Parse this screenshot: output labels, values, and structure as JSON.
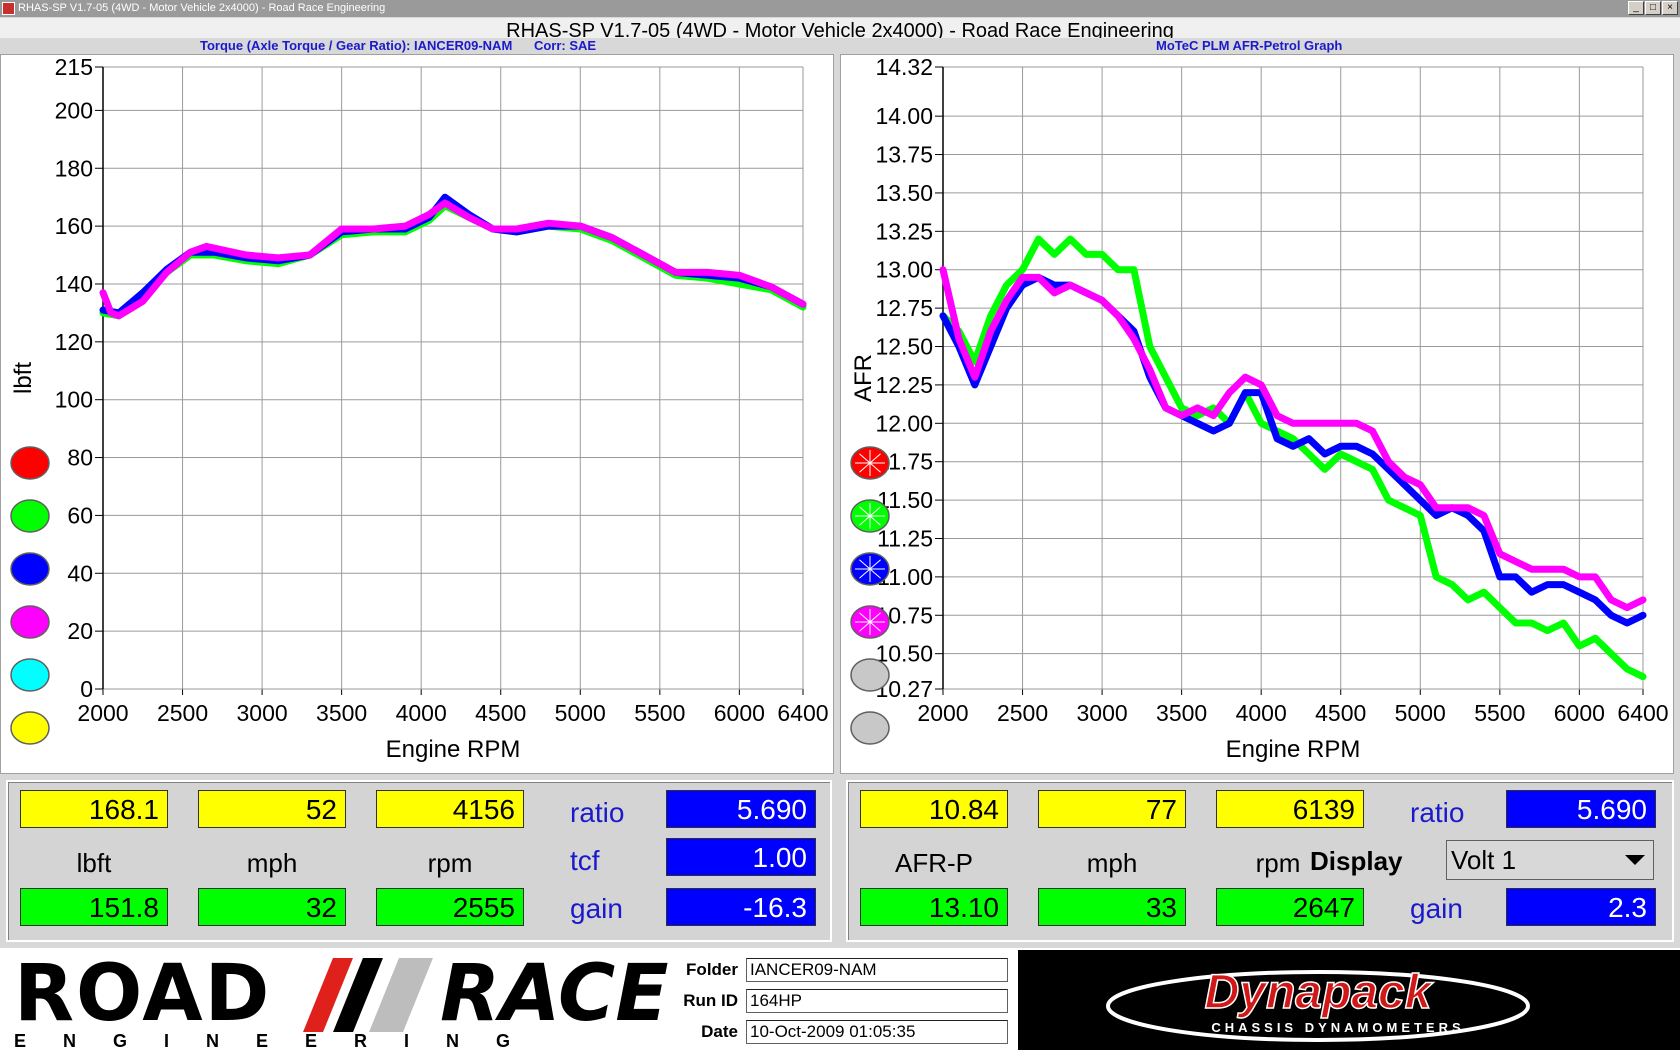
{
  "window": {
    "title": "RHAS-SP V1.7-05   (4WD - Motor Vehicle 2x4000) - Road Race Engineering",
    "heading": "RHAS-SP V1.7-05   (4WD - Motor Vehicle 2x4000) - Road Race Engineering",
    "controls": [
      "_",
      "□",
      "×"
    ]
  },
  "left_graph": {
    "subtitle": "Torque (Axle Torque / Gear Ratio): IANCER09-NAM      Corr: SAE",
    "legend_colors": [
      "#ff0000",
      "#00ff00",
      "#0000ff",
      "#ff00ff",
      "#00ffff",
      "#ffff00"
    ]
  },
  "right_graph": {
    "subtitle": "MoTeC PLM AFR-Petrol Graph",
    "legend_colors": [
      "#ff0000",
      "#00ff00",
      "#0000ff",
      "#ff00ff",
      "#c8c8c8",
      "#c8c8c8"
    ]
  },
  "chart_data": [
    {
      "type": "line",
      "title": "Torque (Axle Torque / Gear Ratio): IANCER09-NAM      Corr: SAE",
      "xlabel": "Engine RPM",
      "ylabel": "lbft",
      "xlim": [
        2000,
        6400
      ],
      "ylim": [
        0,
        215
      ],
      "xticks": [
        2000,
        2500,
        3000,
        3500,
        4000,
        4500,
        5000,
        5500,
        6000,
        6400
      ],
      "yticks": [
        0,
        20,
        40,
        60,
        80,
        100,
        120,
        140,
        160,
        180,
        200,
        215
      ],
      "grid": true,
      "series": [
        {
          "color": "#00ff00",
          "x": [
            2000,
            2100,
            2250,
            2400,
            2550,
            2700,
            2900,
            3100,
            3300,
            3500,
            3700,
            3900,
            4050,
            4150,
            4300,
            4450,
            4600,
            4800,
            5000,
            5200,
            5400,
            5600,
            5800,
            6000,
            6200,
            6400
          ],
          "values": [
            130,
            129,
            136,
            144,
            150,
            150,
            148,
            147,
            150,
            157,
            158,
            158,
            162,
            167,
            163,
            159,
            158,
            160,
            159,
            155,
            149,
            143,
            142,
            140,
            138,
            132
          ]
        },
        {
          "color": "#0000ff",
          "x": [
            2000,
            2100,
            2250,
            2400,
            2550,
            2700,
            2900,
            3100,
            3300,
            3500,
            3700,
            3900,
            4050,
            4150,
            4300,
            4450,
            4600,
            4800,
            5000,
            5200,
            5400,
            5600,
            5800,
            6000,
            6200,
            6400
          ],
          "values": [
            131,
            130,
            137,
            145,
            151,
            151,
            149,
            148,
            150,
            158,
            159,
            159,
            163,
            170,
            164,
            159,
            158,
            160,
            160,
            156,
            150,
            144,
            143,
            142,
            139,
            133
          ]
        },
        {
          "color": "#ff00ff",
          "x": [
            2000,
            2050,
            2100,
            2250,
            2400,
            2550,
            2650,
            2900,
            3100,
            3300,
            3500,
            3700,
            3900,
            4050,
            4150,
            4300,
            4450,
            4600,
            4800,
            5000,
            5200,
            5400,
            5600,
            5800,
            6000,
            6200,
            6400
          ],
          "values": [
            137,
            130,
            129,
            134,
            144,
            151,
            153,
            150,
            149,
            150,
            159,
            159,
            160,
            164,
            168,
            163,
            159,
            159,
            161,
            160,
            156,
            150,
            144,
            144,
            143,
            139,
            133
          ]
        }
      ]
    },
    {
      "type": "line",
      "title": "MoTeC PLM AFR-Petrol Graph",
      "xlabel": "Engine RPM",
      "ylabel": "AFR",
      "xlim": [
        2000,
        6400
      ],
      "ylim": [
        10.27,
        14.32
      ],
      "xticks": [
        2000,
        2500,
        3000,
        3500,
        4000,
        4500,
        5000,
        5500,
        6000,
        6400
      ],
      "yticks": [
        10.27,
        10.5,
        10.75,
        11.0,
        11.25,
        11.5,
        11.75,
        12.0,
        12.25,
        12.5,
        12.75,
        13.0,
        13.25,
        13.5,
        13.75,
        14.0,
        14.32
      ],
      "grid": true,
      "series": [
        {
          "color": "#00ff00",
          "x": [
            2000,
            2100,
            2200,
            2300,
            2400,
            2500,
            2600,
            2700,
            2800,
            2900,
            3000,
            3100,
            3200,
            3300,
            3400,
            3500,
            3600,
            3700,
            3800,
            3900,
            4000,
            4100,
            4200,
            4300,
            4400,
            4500,
            4600,
            4700,
            4800,
            4900,
            5000,
            5100,
            5200,
            5300,
            5400,
            5500,
            5600,
            5700,
            5800,
            5900,
            6000,
            6100,
            6200,
            6300,
            6400
          ],
          "values": [
            12.7,
            12.6,
            12.4,
            12.7,
            12.9,
            13.0,
            13.2,
            13.1,
            13.2,
            13.1,
            13.1,
            13.0,
            13.0,
            12.5,
            12.3,
            12.1,
            12.05,
            12.1,
            12.0,
            12.2,
            12.0,
            11.95,
            11.9,
            11.8,
            11.7,
            11.8,
            11.75,
            11.7,
            11.5,
            11.45,
            11.4,
            11.0,
            10.95,
            10.85,
            10.9,
            10.8,
            10.7,
            10.7,
            10.65,
            10.7,
            10.55,
            10.6,
            10.5,
            10.4,
            10.35
          ]
        },
        {
          "color": "#0000ff",
          "x": [
            2000,
            2100,
            2200,
            2300,
            2400,
            2500,
            2600,
            2700,
            2800,
            2900,
            3000,
            3100,
            3200,
            3300,
            3400,
            3500,
            3600,
            3700,
            3800,
            3900,
            4000,
            4100,
            4200,
            4300,
            4400,
            4500,
            4600,
            4700,
            4800,
            4900,
            5000,
            5100,
            5200,
            5300,
            5400,
            5500,
            5600,
            5700,
            5800,
            5900,
            6000,
            6100,
            6200,
            6300,
            6400
          ],
          "values": [
            12.7,
            12.5,
            12.25,
            12.5,
            12.75,
            12.9,
            12.95,
            12.9,
            12.9,
            12.85,
            12.8,
            12.7,
            12.6,
            12.3,
            12.1,
            12.05,
            12.0,
            11.95,
            12.0,
            12.2,
            12.2,
            11.9,
            11.85,
            11.9,
            11.8,
            11.85,
            11.85,
            11.8,
            11.7,
            11.6,
            11.5,
            11.4,
            11.45,
            11.4,
            11.3,
            11.0,
            11.0,
            10.9,
            10.95,
            10.95,
            10.9,
            10.85,
            10.75,
            10.7,
            10.75
          ]
        },
        {
          "color": "#ff00ff",
          "x": [
            2000,
            2100,
            2200,
            2300,
            2400,
            2500,
            2600,
            2700,
            2800,
            2900,
            3000,
            3100,
            3200,
            3300,
            3400,
            3500,
            3600,
            3700,
            3800,
            3900,
            4000,
            4100,
            4200,
            4300,
            4400,
            4500,
            4600,
            4700,
            4800,
            4900,
            5000,
            5100,
            5200,
            5300,
            5400,
            5500,
            5600,
            5700,
            5800,
            5900,
            6000,
            6100,
            6200,
            6300,
            6400
          ],
          "values": [
            13.0,
            12.55,
            12.3,
            12.6,
            12.8,
            12.95,
            12.95,
            12.85,
            12.9,
            12.85,
            12.8,
            12.7,
            12.55,
            12.35,
            12.1,
            12.05,
            12.1,
            12.05,
            12.2,
            12.3,
            12.25,
            12.05,
            12.0,
            12.0,
            12.0,
            12.0,
            12.0,
            11.95,
            11.75,
            11.65,
            11.6,
            11.45,
            11.45,
            11.45,
            11.4,
            11.15,
            11.1,
            11.05,
            11.05,
            11.05,
            11.0,
            11.0,
            10.85,
            10.8,
            10.85
          ]
        }
      ]
    }
  ],
  "left_readout": {
    "top": [
      "168.1",
      "52",
      "4156"
    ],
    "labels": [
      "lbft",
      "mph",
      "rpm"
    ],
    "bottom": [
      "151.8",
      "32",
      "2555"
    ],
    "side_labels": [
      "ratio",
      "tcf",
      "gain"
    ],
    "side_values": [
      "5.690",
      "1.00",
      "-16.3"
    ]
  },
  "right_readout": {
    "top": [
      "10.84",
      "77",
      "6139"
    ],
    "labels": [
      "AFR-P",
      "mph",
      "rpm"
    ],
    "bottom": [
      "13.10",
      "33",
      "2647"
    ],
    "ratio_label": "ratio",
    "ratio_value": "5.690",
    "display_label": "Display",
    "display_select": "Volt 1",
    "gain_label": "gain",
    "gain_value": "2.3"
  },
  "footer": {
    "logo_road": "ROAD",
    "logo_race": "RACE",
    "logo_engineering": "ENGINEERING",
    "folder_label": "Folder",
    "folder_value": "IANCER09-NAM",
    "runid_label": "Run ID",
    "runid_value": "164HP",
    "date_label": "Date",
    "date_value": "10-Oct-2009  01:05:35",
    "dyna_brand": "Dynapack",
    "dyna_tag": "CHASSIS DYNAMOMETERS"
  }
}
